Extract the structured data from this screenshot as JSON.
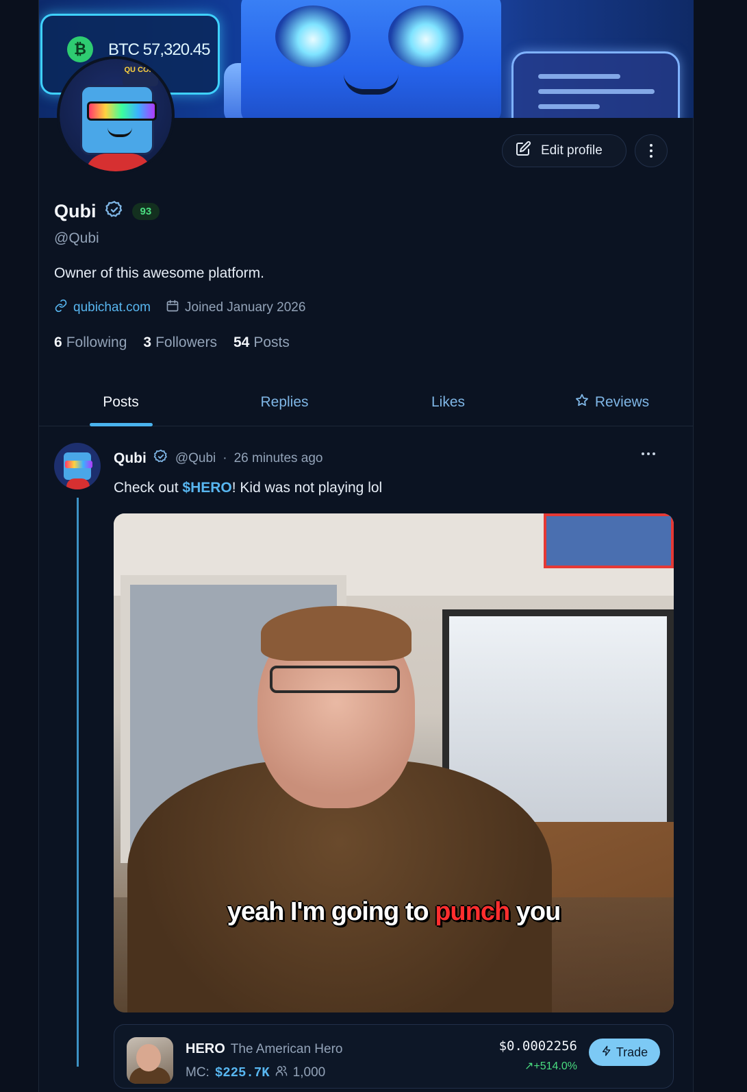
{
  "banner": {
    "btc_ticker": "BTC 57,320.45",
    "btc_plus": "+",
    "cap_text": "QU COIN"
  },
  "profile": {
    "edit_label": "Edit profile",
    "name": "Qubi",
    "score_badge": "93",
    "handle": "@Qubi",
    "bio": "Owner of this awesome platform.",
    "website": "qubichat.com",
    "joined": "Joined January 2026",
    "following_count": "6",
    "following_label": "Following",
    "followers_count": "3",
    "followers_label": "Followers",
    "posts_count": "54",
    "posts_label": "Posts"
  },
  "tabs": [
    {
      "label": "Posts",
      "active": true
    },
    {
      "label": "Replies"
    },
    {
      "label": "Likes"
    },
    {
      "label": "Reviews",
      "icon": "star-icon"
    }
  ],
  "post": {
    "author": "Qubi",
    "handle": "@Qubi",
    "separator": "·",
    "time": "26 minutes ago",
    "text_before": "Check out ",
    "cashtag": "$HERO",
    "text_after": "! Kid was not playing lol",
    "caption_part1": "yeah I'm going to ",
    "caption_highlight": "punch",
    "caption_part2": " you"
  },
  "token": {
    "symbol": "HERO",
    "full_name": "The American Hero",
    "mc_label": "MC:",
    "mc_value": "$225.7K",
    "holders": "1,000",
    "price": "$0.0002256",
    "change": "+514.0%",
    "trade_label": "Trade"
  },
  "colors": {
    "background": "#0b1322",
    "accent": "#4ab3ee",
    "link": "#58b6f0",
    "positive": "#4ade80",
    "caption_highlight": "#ff2e2e",
    "trade_button": "#7cc9f5"
  }
}
